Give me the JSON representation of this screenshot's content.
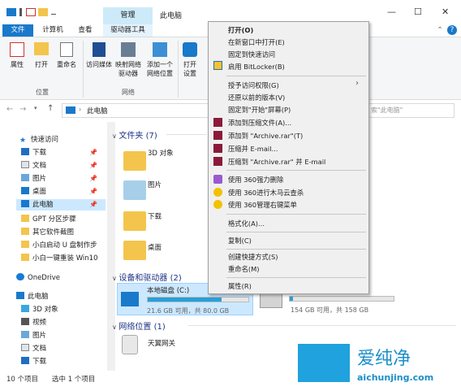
{
  "window": {
    "title": "此电脑",
    "manage_tab": "管理",
    "controls": {
      "minimize": "—",
      "maximize": "☐",
      "close": "✕"
    }
  },
  "ribbon_tabs": {
    "file": "文件",
    "computer": "计算机",
    "view": "查看",
    "drive_tools": "驱动器工具"
  },
  "ribbon": {
    "properties": "属性",
    "open": "打开",
    "rename": "重命名",
    "access_media": "访问媒体",
    "map_drive": [
      "映射网络",
      "驱动器"
    ],
    "add_location": [
      "添加一个",
      "网络位置"
    ],
    "open_settings": [
      "打开",
      "设置"
    ],
    "group_location": "位置",
    "group_network": "网络"
  },
  "nav": {
    "breadcrumb_root": "此电脑",
    "search_placeholder": "索\"此电脑\""
  },
  "sidebar": {
    "quick_access": "快速访问",
    "items": [
      "下载",
      "文档",
      "图片",
      "桌面",
      "此电脑",
      "GPT 分区步骤",
      "其它软件截图",
      "小白启动 U 盘制作步",
      "小白一键重装 Win10"
    ],
    "onedrive": "OneDrive",
    "this_pc": "此电脑",
    "pc_items": [
      "3D 对象",
      "视频",
      "图片",
      "文档",
      "下载"
    ]
  },
  "content": {
    "folders_header": "文件夹 (7)",
    "folders": [
      "3D 对象",
      "图片",
      "下载",
      "桌面"
    ],
    "drives_header": "设备和驱动器 (2)",
    "drive_c": {
      "name": "本地磁盘 (C:)",
      "space": "21.6 GB 可用，共 80.0 GB",
      "used_fraction": 0.73
    },
    "drive_d": {
      "space": "154 GB 可用，共 158 GB",
      "used_fraction": 0.03
    },
    "network_header": "网络位置 (1)",
    "network_item": "天翼网关"
  },
  "status": {
    "count": "10 个项目",
    "selected": "选中 1 个项目"
  },
  "context_menu": {
    "items": [
      {
        "label": "打开(O)",
        "bold": true
      },
      {
        "label": "在新窗口中打开(E)"
      },
      {
        "label": "固定到快速访问"
      },
      {
        "label": "启用 BitLocker(B)"
      },
      {
        "label": "授予访问权限(G)",
        "submenu": true
      },
      {
        "label": "还原以前的版本(V)"
      },
      {
        "label": "固定到\"开始\"屏幕(P)"
      },
      {
        "label": "添加到压缩文件(A)..."
      },
      {
        "label": "添加到 \"Archive.rar\"(T)"
      },
      {
        "label": "压缩并 E-mail..."
      },
      {
        "label": "压缩到 \"Archive.rar\" 并 E-mail"
      },
      {
        "label": "使用 360强力删除"
      },
      {
        "label": "使用 360进行木马云查杀"
      },
      {
        "label": "使用 360管理右键菜单"
      },
      {
        "label": "格式化(A)..."
      },
      {
        "label": "复制(C)"
      },
      {
        "label": "创建快捷方式(S)"
      },
      {
        "label": "重命名(M)"
      },
      {
        "label": "属性(R)"
      }
    ]
  },
  "watermark": {
    "text": "爱纯净",
    "url": "aichunjing.com"
  },
  "colors": {
    "accent": "#1979ca",
    "selected": "#cce8ff",
    "drive_bar": "#26a0da"
  }
}
